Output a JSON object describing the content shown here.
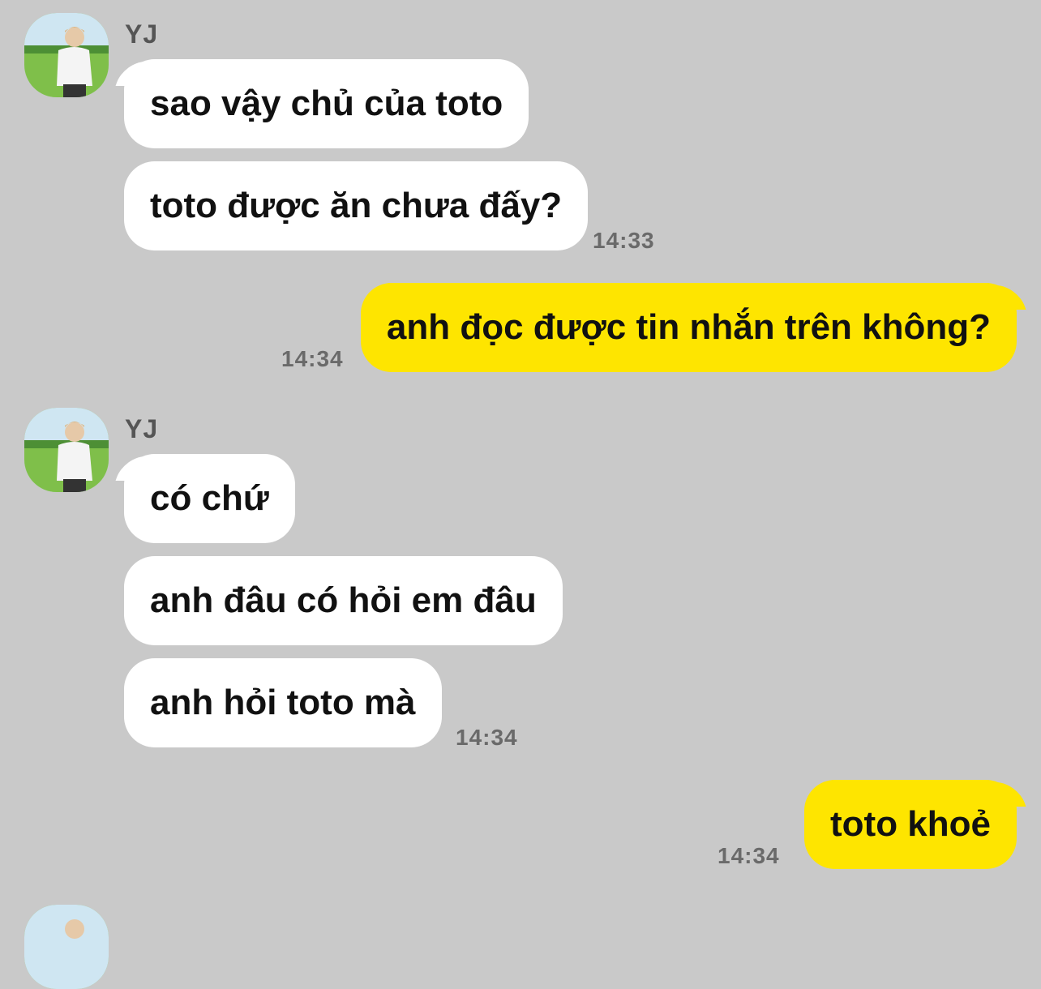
{
  "chat": {
    "groups": [
      {
        "sender": "YJ",
        "messages": [
          "sao vậy chủ của toto",
          "toto được ăn chưa đấy?"
        ],
        "time": "14:33"
      },
      {
        "mine": true,
        "messages": [
          "anh đọc được tin nhắn trên không?"
        ],
        "time": "14:34"
      },
      {
        "sender": "YJ",
        "messages": [
          "có chứ",
          "anh đâu có hỏi em đâu",
          "anh hỏi toto mà"
        ],
        "time": "14:34"
      },
      {
        "mine": true,
        "messages": [
          "toto khoẻ"
        ],
        "time": "14:34"
      }
    ]
  },
  "colors": {
    "background": "#c9c9c9",
    "incoming_bubble": "#ffffff",
    "outgoing_bubble": "#fee500",
    "timestamp": "#6a6a6a"
  },
  "icons": {
    "avatar": "profile-photo-avatar"
  }
}
